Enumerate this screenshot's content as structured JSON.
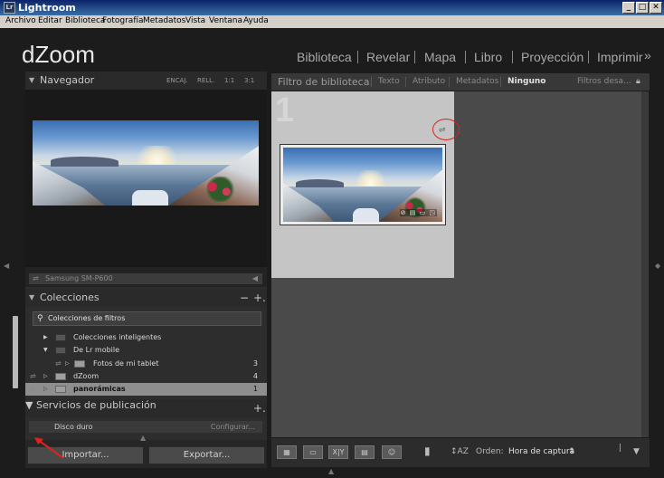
{
  "window": {
    "title": "Lightroom",
    "icon_text": "Lr",
    "controls": [
      "_",
      "□",
      "✕"
    ]
  },
  "menu": [
    "Archivo",
    "Editar",
    "Biblioteca",
    "Fotografía",
    "Metadatos",
    "Vista",
    "Ventana",
    "Ayuda"
  ],
  "identity_plate": "dZoom",
  "modules": {
    "items": [
      "Biblioteca",
      "Revelar",
      "Mapa",
      "Libro",
      "Proyección",
      "Imprimir"
    ],
    "active": "Biblioteca",
    "overflow": "»"
  },
  "navigator": {
    "title": "Navegador",
    "options": [
      "ENCAJ.",
      "RELL.",
      "1:1",
      "3:1"
    ]
  },
  "device_row": {
    "label": "Samsung SM-P600"
  },
  "collections": {
    "title": "Colecciones",
    "minus": "−",
    "plus": "+.",
    "filter_placeholder": "Colecciones de filtros",
    "rows": [
      {
        "label": "Colecciones inteligentes",
        "count": ""
      },
      {
        "label": "De Lr mobile",
        "count": ""
      },
      {
        "label": "Fotos de mi tablet",
        "count": "3"
      },
      {
        "label": "dZoom",
        "count": "4"
      },
      {
        "label": "panorámicas",
        "count": "1"
      }
    ]
  },
  "publish": {
    "title": "Servicios de publicación",
    "plus": "+.",
    "disk": "Disco duro",
    "configure": "Configurar..."
  },
  "buttons": {
    "import": "Importar...",
    "export": "Exportar..."
  },
  "library_filter": {
    "title": "Filtro de biblioteca:",
    "options": [
      "Texto",
      "Atributo",
      "Metadatos",
      "Ninguno"
    ],
    "active": "Ninguno",
    "preset": "Filtros desa...",
    "lock_icon": "lock-icon"
  },
  "grid": {
    "cell_number": "1",
    "badges": "⊘ ▤ ▭ ◳"
  },
  "toolbar": {
    "view_buttons": [
      "▦",
      "▭",
      "X|Y",
      "▤",
      "☺"
    ],
    "sort_label": "Orden:",
    "sort_value": "Hora de captura",
    "paint_icon": "spray-can-icon",
    "az_icon": "sort-direction-icon"
  },
  "colors": {
    "background": "#1c1c1c",
    "panel": "#2d2d2d",
    "grid": "#4a4a4a",
    "selected_row": "#8e8e8e",
    "annotation": "#dd2222"
  }
}
